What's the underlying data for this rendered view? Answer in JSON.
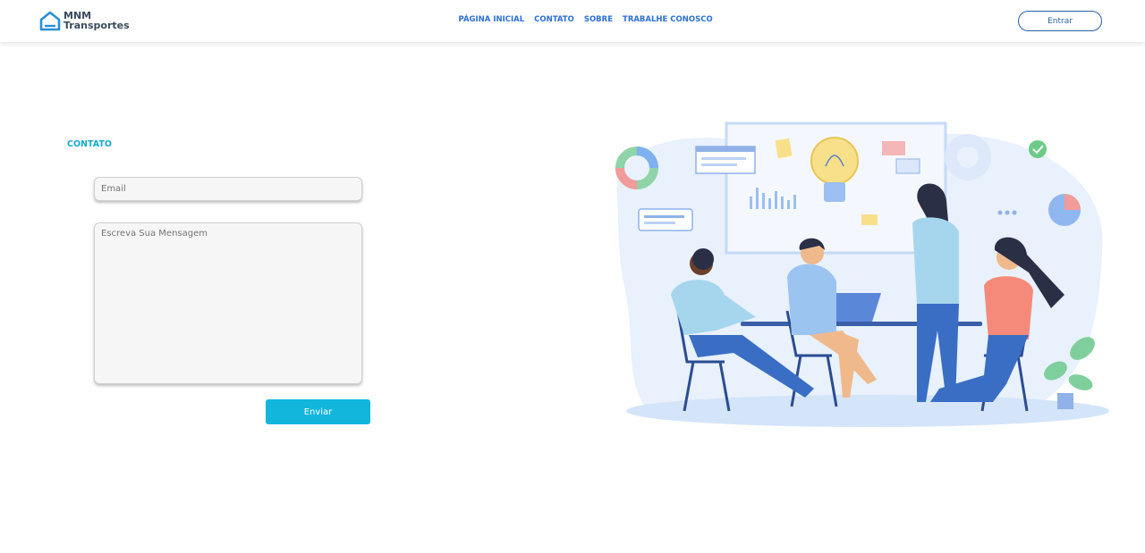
{
  "brand": {
    "line1": "MNM",
    "line2": "Transportes"
  },
  "nav": {
    "items": [
      "PÁGINA INICIAL",
      "CONTATO",
      "SOBRE",
      "TRABALHE CONOSCO"
    ]
  },
  "header": {
    "login_label": "Entrar"
  },
  "contact": {
    "title": "CONTATO",
    "email_placeholder": "Email",
    "message_placeholder": "Escreva Sua Mensagem",
    "send_label": "Enviar"
  },
  "colors": {
    "accent": "#12b6dc",
    "nav": "#2a6fd6",
    "brand": "#3a4a5c"
  }
}
